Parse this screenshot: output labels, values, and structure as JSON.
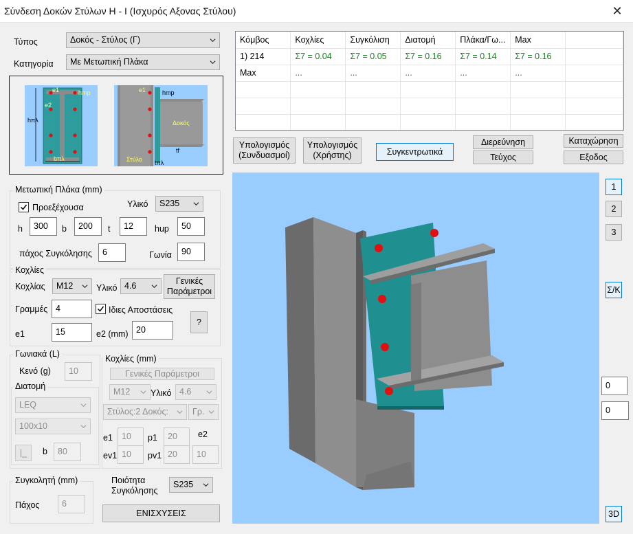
{
  "window": {
    "title": "Σύνδεση Δοκών Στύλων H - I (Ισχυρός Αξονας Στύλου)"
  },
  "type": {
    "label": "Τύπος",
    "value": "Δοκός - Στύλος (Γ)"
  },
  "category": {
    "label": "Κατηγορία",
    "value": "Με Μετωπική Πλάκα"
  },
  "diagram": {
    "e1": "e1",
    "e2": "e2",
    "hmp": "hmp",
    "hpl": "hπλ",
    "bpl": "bπλ",
    "e1b": "e1",
    "hmpb": "hmp",
    "dokos": "Δοκός",
    "tf": "tf",
    "stylos": "Στύλο",
    "tpl": "tπλ"
  },
  "end_plate": {
    "title": "Μετωπική Πλάκα (mm)",
    "protruding_label": "Προεξέχουσα",
    "material_label": "Υλικό",
    "material": "S235",
    "h_label": "h",
    "h": "300",
    "b_label": "b",
    "b": "200",
    "t_label": "t",
    "t": "12",
    "hup_label": "hup",
    "hup": "50",
    "weld_label": "πάχος Συγκόλησης",
    "weld": "6",
    "angle_label": "Γωνία",
    "angle": "90"
  },
  "bolts": {
    "title": "Κοχλίες",
    "bolt_label": "Κοχλίας",
    "bolt": "M12",
    "material_label": "Υλικό",
    "material": "4.6",
    "general_btn": "Γενικές\nΠαράμετροι",
    "rows_label": "Γραμμές",
    "rows": "4",
    "same_dist_label": "Ιδιες Αποστάσεις",
    "help_btn": "?",
    "e1_label": "e1",
    "e1": "15",
    "e2_label": "e2 (mm)",
    "e2": "20"
  },
  "angles": {
    "title": "Γωνιακά (L)",
    "gap_label": "Κενό (g)",
    "gap": "10",
    "section_label": "Διατομή",
    "section": "LEQ",
    "size": "100x10",
    "shape_btn": "|_",
    "b_label": "b",
    "b": "80"
  },
  "angle_bolts": {
    "title": "Κοχλίες (mm)",
    "general_btn": "Γενικές Παράμετροι",
    "bolt": "M12",
    "material_label": "Υλικό",
    "material": "4.6",
    "position": "Στύλος:2 Δοκός:",
    "row": "Γρ.",
    "e1_label": "e1",
    "e1": "10",
    "p1_label": "p1",
    "p1": "20",
    "e2_label": "e2",
    "ev1_label": "ev1",
    "ev1": "10",
    "pv1_label": "pv1",
    "pv1": "20",
    "e2": "10"
  },
  "weld": {
    "title": "Συγκολητή (mm)",
    "thickness_label": "Πάχος",
    "thickness": "6",
    "quality_label": "Ποιότητα\nΣυγκόλησης",
    "quality": "S235"
  },
  "reinforcements_btn": "ΕΝΙΣΧΥΣΕΙΣ",
  "results": {
    "headers": [
      "Κόμβος",
      "Κοχλίες",
      "Συγκόλιση",
      "Διατομή",
      "Πλάκα/Γω...",
      "Max"
    ],
    "row1": {
      "node": "1) 214",
      "values": [
        "Σ7 = 0.04",
        "Σ7 = 0.05",
        "Σ7 = 0.16",
        "Σ7 = 0.14",
        "Σ7 = 0.16"
      ]
    },
    "row2": {
      "node": "Max",
      "values": [
        "...",
        "...",
        "...",
        "...",
        "..."
      ]
    }
  },
  "actions": {
    "calc_combos": "Υπολογισμός\n(Συνδυασμοί)",
    "calc_user": "Υπολογισμός\n(Χρήστης)",
    "summary": "Συγκεντρωτικά",
    "investigate": "Διερεύνηση",
    "booklet": "Τεύχος",
    "register": "Καταχώρηση",
    "exit": "Εξοδος"
  },
  "view_buttons": {
    "v1": "1",
    "v2": "2",
    "v3": "3",
    "sk": "Σ/Κ",
    "val1": "0",
    "val2": "0",
    "threed": "3D"
  },
  "colors": {
    "viewport_bg": "#99ccff",
    "steel": "#777777",
    "plate": "#1f8f8f",
    "bolt": "#e01010",
    "accent": "#0078d7",
    "result_green": "#18801c"
  }
}
